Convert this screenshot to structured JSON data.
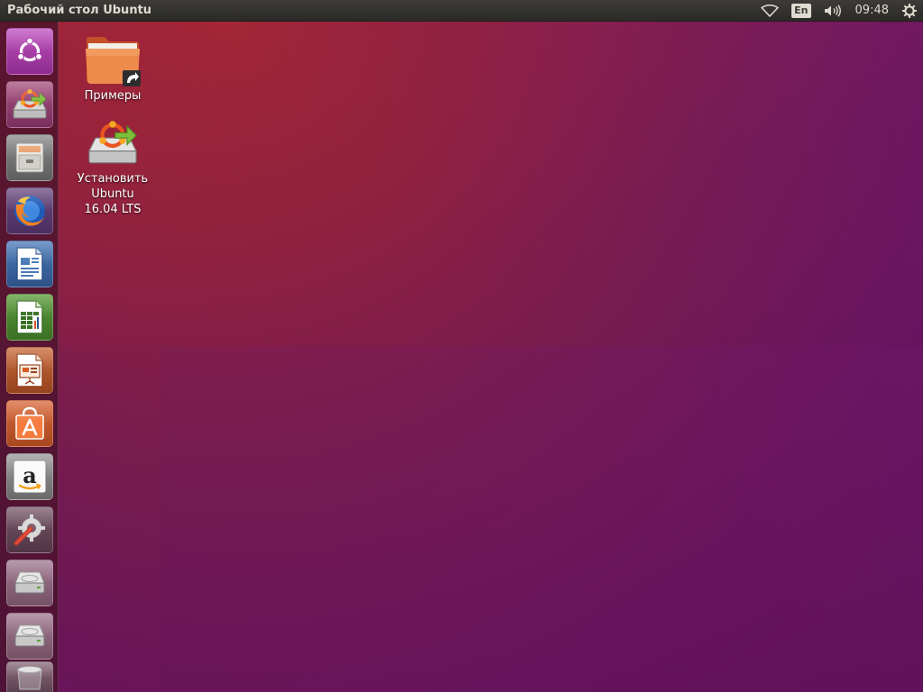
{
  "panel": {
    "title": "Рабочий стол Ubuntu",
    "language": "En",
    "time": "09:48"
  },
  "desktop": {
    "icons": [
      {
        "label": "Примеры",
        "icon": "folder-link-icon"
      },
      {
        "label_lines": [
          "Установить",
          "Ubuntu",
          "16.04 LTS"
        ],
        "icon": "ubuntu-installer-icon"
      }
    ]
  },
  "launcher": {
    "items": [
      {
        "name": "dash-home",
        "icon": "ubuntu-logo-icon"
      },
      {
        "name": "install-ubuntu",
        "icon": "ubuntu-installer-icon"
      },
      {
        "name": "files",
        "icon": "file-cabinet-icon"
      },
      {
        "name": "firefox",
        "icon": "firefox-icon"
      },
      {
        "name": "libreoffice-writer",
        "icon": "writer-icon"
      },
      {
        "name": "libreoffice-calc",
        "icon": "calc-icon"
      },
      {
        "name": "libreoffice-impress",
        "icon": "impress-icon"
      },
      {
        "name": "ubuntu-software",
        "icon": "software-center-icon"
      },
      {
        "name": "amazon",
        "icon": "amazon-icon"
      },
      {
        "name": "system-settings",
        "icon": "settings-icon"
      },
      {
        "name": "drive-1",
        "icon": "hard-drive-icon"
      },
      {
        "name": "drive-2",
        "icon": "hard-drive-icon"
      },
      {
        "name": "trash",
        "icon": "trash-icon"
      }
    ]
  },
  "colors": {
    "panel": "#3c3b37",
    "accent_orange": "#e95420",
    "wallpaper_top": "#9d2535",
    "wallpaper_bottom": "#5c1157"
  }
}
